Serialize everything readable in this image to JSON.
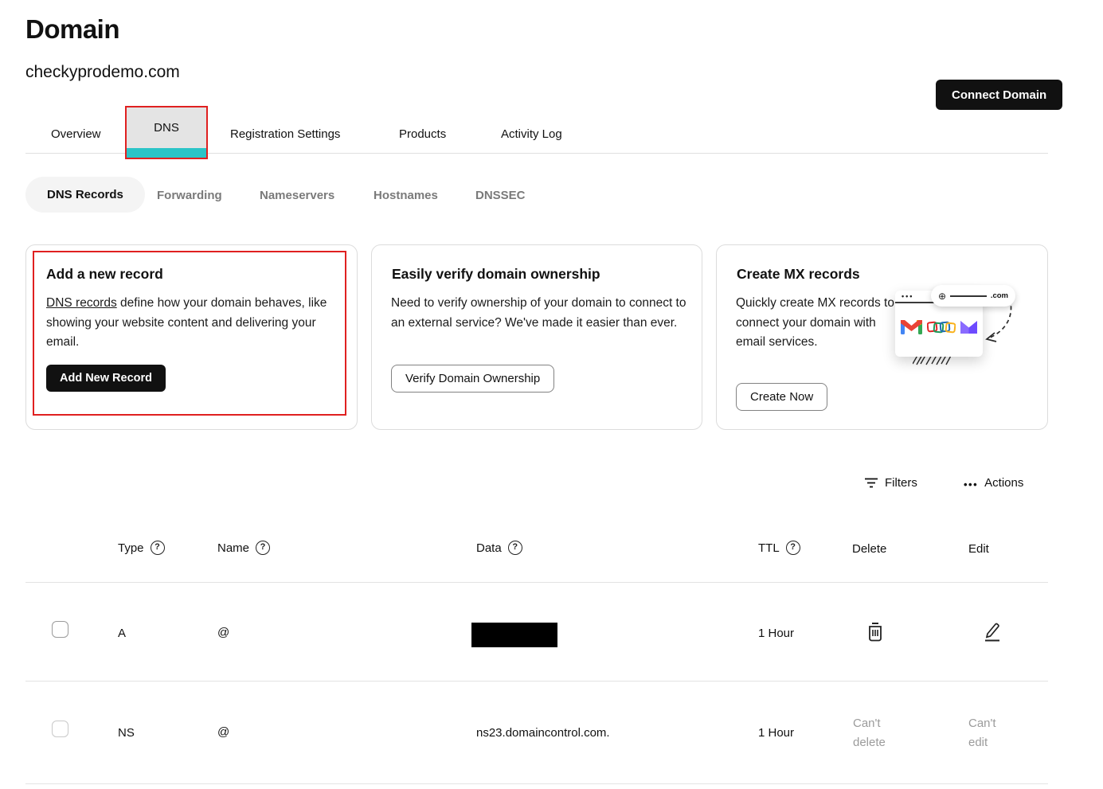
{
  "page": {
    "title": "Domain",
    "domain": "checkyprodemo.com",
    "connect_button": "Connect Domain"
  },
  "tabs": [
    {
      "label": "Overview",
      "active": false
    },
    {
      "label": "DNS",
      "active": true
    },
    {
      "label": "Registration Settings",
      "active": false
    },
    {
      "label": "Products",
      "active": false
    },
    {
      "label": "Activity Log",
      "active": false
    }
  ],
  "subnav": [
    {
      "label": "DNS Records",
      "active": true
    },
    {
      "label": "Forwarding",
      "active": false
    },
    {
      "label": "Nameservers",
      "active": false
    },
    {
      "label": "Hostnames",
      "active": false
    },
    {
      "label": "DNSSEC",
      "active": false
    }
  ],
  "cards": [
    {
      "title": "Add a new record",
      "body_link": "DNS records",
      "body_rest": " define how your domain behaves, like showing your website content and delivering your email.",
      "button": "Add New Record"
    },
    {
      "title": "Easily verify domain ownership",
      "body": "Need to verify ownership of your domain to connect to an external service? We've made it easier than ever.",
      "button": "Verify Domain Ownership"
    },
    {
      "title": "Create MX records",
      "body": "Quickly create MX records to connect your domain with email services.",
      "button": "Create Now",
      "illustration": {
        "dotcom": ".com",
        "globe": "⊕",
        "browser_dots": "•••"
      }
    }
  ],
  "toolbar": {
    "filters_label": "Filters",
    "actions_label": "Actions",
    "actions_icon": "•••"
  },
  "icons": {
    "help": "?"
  },
  "table": {
    "headers": {
      "type": "Type",
      "name": "Name",
      "data": "Data",
      "ttl": "TTL",
      "del": "Delete",
      "edit": "Edit"
    },
    "rows": [
      {
        "type": "A",
        "name": "@",
        "data_redacted": true,
        "ttl": "1 Hour"
      },
      {
        "type": "NS",
        "name": "@",
        "data": "ns23.domaincontrol.com.",
        "ttl": "1 Hour",
        "delete_note": "Can't delete",
        "edit_note": "Can't edit"
      }
    ]
  },
  "colors": {
    "accent_teal": "#2bc4c7",
    "annotation_red": "#e02020",
    "primary_black": "#111111"
  }
}
